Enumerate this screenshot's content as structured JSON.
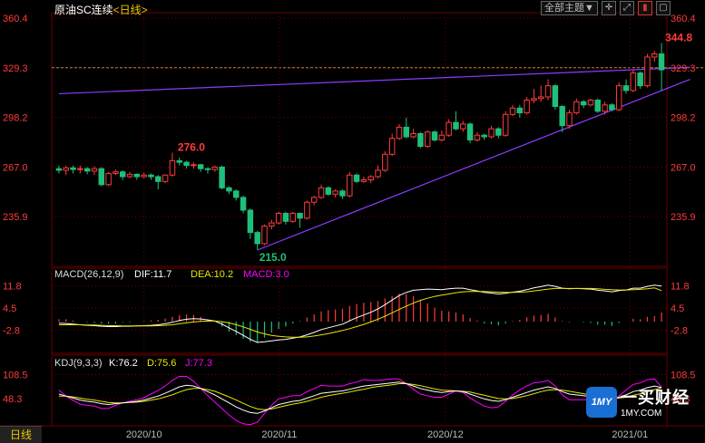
{
  "header": {
    "title": "原油SC连续",
    "period": "<日线>",
    "theme_button": "全部主题▼",
    "icons": [
      "crosshair-icon",
      "expand-icon",
      "chart-mode-icon",
      "window-icon"
    ]
  },
  "bottom_tab": "日线",
  "logo": {
    "badge": "1MY",
    "cn": "一买财经",
    "url": "1MY.COM"
  },
  "colors": {
    "up": "#ff3b3b",
    "down": "#1fbf7a",
    "trend": "#8a3cff",
    "dif": "#ffffff",
    "dea": "#e8e800",
    "macd_label": "#ff00ff",
    "k": "#ffffff",
    "d": "#e8e800",
    "j": "#ff00ff",
    "price_label": "#ff3b3b",
    "grid": "#6b0000"
  },
  "chart_data": [
    {
      "type": "candlestick",
      "ylim": [
        215.0,
        360.4
      ],
      "yticks": [
        "360.4",
        "329.3",
        "298.2",
        "267.0",
        "235.9"
      ],
      "xticks": [
        "2020/10",
        "2020/11",
        "2020/12",
        "2021/01"
      ],
      "last_price_ref": "329.3",
      "annotations": {
        "high": "344.8",
        "high_value": 344.8,
        "peak": "276.0",
        "peak_value": 276.0,
        "low": "215.0",
        "low_value": 215.0
      },
      "candles": [
        [
          266.0,
          265.0,
          268.0,
          263.0
        ],
        [
          265.0,
          266.5,
          268.0,
          262.0
        ],
        [
          266.5,
          265.5,
          268.0,
          263.0
        ],
        [
          265.5,
          266.0,
          268.0,
          263.0
        ],
        [
          266.0,
          264.5,
          267.0,
          262.5
        ],
        [
          264.5,
          266.0,
          267.5,
          262.0
        ],
        [
          266.0,
          256.0,
          267.0,
          255.0
        ],
        [
          256.0,
          263.0,
          264.0,
          255.0
        ],
        [
          263.0,
          264.0,
          265.5,
          262.0
        ],
        [
          264.0,
          261.0,
          265.0,
          259.0
        ],
        [
          261.0,
          262.5,
          264.0,
          260.0
        ],
        [
          262.5,
          261.0,
          263.0,
          259.0
        ],
        [
          261.0,
          262.0,
          263.5,
          260.0
        ],
        [
          262.0,
          261.0,
          263.0,
          259.0
        ],
        [
          261.0,
          258.0,
          262.0,
          253.0
        ],
        [
          258.0,
          262.0,
          262.5,
          257.0
        ],
        [
          262.0,
          271.0,
          276.0,
          261.0
        ],
        [
          271.0,
          270.0,
          273.0,
          268.0
        ],
        [
          270.0,
          268.0,
          271.0,
          266.0
        ],
        [
          268.0,
          268.5,
          270.0,
          266.0
        ],
        [
          268.5,
          266.0,
          269.0,
          264.0
        ],
        [
          266.0,
          265.5,
          267.0,
          263.0
        ],
        [
          265.5,
          267.0,
          268.0,
          264.0
        ],
        [
          267.0,
          254.0,
          268.0,
          253.0
        ],
        [
          254.0,
          252.0,
          255.0,
          250.0
        ],
        [
          252.0,
          248.0,
          253.0,
          246.0
        ],
        [
          248.0,
          240.0,
          249.0,
          238.0
        ],
        [
          240.0,
          226.0,
          241.0,
          222.0
        ],
        [
          226.0,
          219.0,
          227.0,
          215.0
        ],
        [
          219.0,
          230.0,
          231.0,
          218.0
        ],
        [
          230.0,
          232.0,
          234.0,
          228.0
        ],
        [
          232.0,
          238.0,
          239.0,
          231.0
        ],
        [
          238.0,
          233.0,
          239.0,
          231.0
        ],
        [
          233.0,
          238.0,
          239.0,
          232.0
        ],
        [
          238.0,
          235.0,
          238.5,
          229.0
        ],
        [
          235.0,
          245.0,
          246.0,
          234.0
        ],
        [
          245.0,
          248.0,
          249.0,
          243.0
        ],
        [
          248.0,
          254.0,
          256.0,
          247.0
        ],
        [
          254.0,
          250.0,
          255.0,
          249.0
        ],
        [
          250.0,
          252.0,
          253.0,
          248.0
        ],
        [
          252.0,
          249.0,
          253.0,
          247.0
        ],
        [
          249.0,
          262.0,
          264.0,
          248.0
        ],
        [
          262.0,
          258.0,
          263.0,
          257.0
        ],
        [
          258.0,
          259.0,
          261.0,
          257.0
        ],
        [
          259.0,
          261.0,
          262.0,
          257.0
        ],
        [
          261.0,
          265.0,
          268.0,
          260.0
        ],
        [
          265.0,
          275.0,
          277.0,
          264.0
        ],
        [
          275.0,
          285.0,
          288.0,
          274.0
        ],
        [
          285.0,
          292.0,
          294.0,
          284.0
        ],
        [
          292.0,
          286.0,
          298.0,
          285.0
        ],
        [
          286.0,
          288.0,
          291.0,
          285.0
        ],
        [
          288.0,
          280.0,
          289.0,
          279.0
        ],
        [
          280.0,
          289.0,
          290.0,
          279.0
        ],
        [
          289.0,
          284.0,
          290.0,
          283.0
        ],
        [
          284.0,
          287.0,
          290.0,
          283.0
        ],
        [
          287.0,
          295.0,
          297.0,
          286.0
        ],
        [
          295.0,
          291.0,
          302.0,
          290.0
        ],
        [
          291.0,
          294.0,
          296.0,
          289.0
        ],
        [
          294.0,
          284.0,
          295.0,
          282.0
        ],
        [
          284.0,
          287.0,
          289.0,
          283.0
        ],
        [
          287.0,
          286.0,
          288.0,
          284.0
        ],
        [
          286.0,
          291.0,
          293.0,
          285.0
        ],
        [
          291.0,
          287.0,
          292.0,
          285.0
        ],
        [
          287.0,
          300.0,
          302.0,
          286.0
        ],
        [
          300.0,
          304.0,
          306.0,
          299.0
        ],
        [
          304.0,
          301.0,
          306.0,
          298.0
        ],
        [
          301.0,
          309.0,
          311.0,
          300.0
        ],
        [
          309.0,
          310.0,
          316.0,
          307.0
        ],
        [
          310.0,
          311.0,
          318.0,
          308.0
        ],
        [
          311.0,
          318.0,
          322.0,
          309.0
        ],
        [
          318.0,
          305.0,
          319.0,
          303.0
        ],
        [
          305.0,
          293.0,
          306.0,
          289.0
        ],
        [
          293.0,
          301.0,
          303.0,
          291.0
        ],
        [
          301.0,
          308.0,
          310.0,
          300.0
        ],
        [
          308.0,
          306.0,
          309.0,
          304.0
        ],
        [
          306.0,
          309.0,
          310.0,
          305.0
        ],
        [
          309.0,
          302.0,
          310.0,
          301.0
        ],
        [
          302.0,
          306.0,
          308.0,
          300.0
        ],
        [
          306.0,
          303.0,
          307.0,
          302.0
        ],
        [
          303.0,
          318.0,
          320.0,
          302.0
        ],
        [
          318.0,
          315.0,
          322.0,
          313.0
        ],
        [
          315.0,
          326.0,
          328.0,
          314.0
        ],
        [
          326.0,
          318.0,
          327.0,
          316.0
        ],
        [
          318.0,
          336.0,
          338.0,
          317.0
        ],
        [
          336.0,
          338.0,
          340.0,
          333.0
        ],
        [
          338.0,
          328.0,
          344.8,
          315.0
        ]
      ],
      "trendlines": [
        {
          "from": [
            0,
            313.0
          ],
          "to": [
            88,
            329.5
          ]
        },
        {
          "from": [
            28,
            215.0
          ],
          "to": [
            88,
            322.0
          ]
        }
      ]
    },
    {
      "type": "macd",
      "label": "MACD(26,12,9)",
      "series_labels": {
        "dif": "DIF:11.7",
        "dea": "DEA:10.2",
        "macd": "MACD:3.0"
      },
      "ylim": [
        -8.0,
        14.0
      ],
      "yticks": [
        "11.8",
        "4.5",
        "-2.8"
      ],
      "dif": [
        -0.5,
        -0.6,
        -0.8,
        -1.0,
        -1.2,
        -1.3,
        -1.5,
        -1.6,
        -1.6,
        -1.5,
        -1.5,
        -1.4,
        -1.3,
        -1.2,
        -1.0,
        -0.7,
        -0.2,
        0.4,
        0.8,
        1.0,
        0.9,
        0.6,
        0.2,
        -0.8,
        -2.0,
        -3.2,
        -4.5,
        -5.8,
        -6.8,
        -6.6,
        -6.3,
        -6.0,
        -5.8,
        -5.4,
        -5.0,
        -4.3,
        -3.5,
        -2.6,
        -2.0,
        -1.4,
        -0.8,
        0.3,
        1.3,
        2.2,
        3.1,
        4.2,
        5.6,
        7.1,
        8.6,
        9.6,
        10.3,
        10.5,
        10.7,
        10.6,
        10.5,
        10.8,
        11.0,
        11.0,
        10.5,
        10.1,
        9.6,
        9.4,
        9.1,
        9.3,
        9.7,
        10.0,
        10.5,
        11.1,
        11.5,
        12.0,
        11.6,
        11.0,
        10.8,
        10.9,
        10.8,
        10.7,
        10.3,
        10.1,
        9.8,
        10.2,
        10.4,
        11.0,
        11.0,
        11.6,
        12.0,
        11.7
      ],
      "dea": [
        -1.0,
        -1.0,
        -1.0,
        -1.0,
        -1.1,
        -1.1,
        -1.2,
        -1.3,
        -1.3,
        -1.4,
        -1.4,
        -1.4,
        -1.4,
        -1.4,
        -1.3,
        -1.2,
        -1.0,
        -0.7,
        -0.4,
        -0.1,
        0.1,
        0.2,
        0.2,
        0.0,
        -0.4,
        -1.0,
        -1.7,
        -2.5,
        -3.4,
        -4.0,
        -4.5,
        -4.8,
        -5.0,
        -5.1,
        -5.1,
        -5.0,
        -4.7,
        -4.3,
        -3.9,
        -3.4,
        -2.9,
        -2.3,
        -1.6,
        -0.9,
        -0.1,
        0.8,
        1.8,
        2.9,
        4.0,
        5.1,
        6.1,
        7.0,
        7.7,
        8.3,
        8.7,
        9.1,
        9.5,
        9.8,
        9.9,
        9.9,
        9.9,
        9.8,
        9.7,
        9.6,
        9.6,
        9.7,
        9.8,
        10.1,
        10.4,
        10.7,
        10.9,
        10.9,
        10.9,
        10.9,
        10.9,
        10.9,
        10.8,
        10.6,
        10.5,
        10.4,
        10.4,
        10.5,
        10.6,
        10.8,
        11.1,
        10.2
      ],
      "hist": [
        0.8,
        0.8,
        0.4,
        0.0,
        -0.2,
        -0.4,
        -0.6,
        -0.6,
        -0.6,
        -0.2,
        -0.2,
        0.0,
        0.2,
        0.4,
        0.6,
        1.0,
        1.6,
        2.2,
        2.4,
        2.2,
        1.6,
        0.8,
        0.0,
        -1.6,
        -3.2,
        -4.4,
        -5.6,
        -6.6,
        -6.8,
        -5.2,
        -3.6,
        -2.4,
        -1.6,
        -0.6,
        0.2,
        1.4,
        2.4,
        3.4,
        3.8,
        4.0,
        4.2,
        5.2,
        5.8,
        6.2,
        6.4,
        6.8,
        7.6,
        8.4,
        9.2,
        9.0,
        8.4,
        7.0,
        6.0,
        4.6,
        3.6,
        3.4,
        3.0,
        2.4,
        1.2,
        0.4,
        -0.6,
        -0.8,
        -1.2,
        -0.6,
        0.2,
        0.6,
        1.4,
        2.0,
        2.2,
        2.6,
        1.4,
        0.2,
        -0.2,
        0.0,
        -0.2,
        -0.4,
        -1.0,
        -1.0,
        -1.4,
        -0.4,
        0.0,
        1.0,
        0.8,
        1.6,
        1.8,
        3.0
      ]
    },
    {
      "type": "kdj",
      "label": "KDJ(9,3,3)",
      "series_labels": {
        "k": "K:76.2",
        "d": "D:75.6",
        "j": "J:77.3"
      },
      "ylim": [
        -10.0,
        130.0
      ],
      "yticks": [
        "108.5",
        "48.3"
      ],
      "k": [
        60,
        55,
        50,
        45,
        42,
        40,
        36,
        34,
        36,
        38,
        40,
        42,
        45,
        50,
        55,
        62,
        70,
        78,
        82,
        80,
        74,
        66,
        58,
        48,
        38,
        28,
        20,
        14,
        12,
        18,
        26,
        34,
        38,
        42,
        44,
        50,
        56,
        62,
        64,
        66,
        68,
        72,
        76,
        80,
        82,
        84,
        86,
        88,
        90,
        86,
        80,
        74,
        70,
        66,
        64,
        66,
        68,
        66,
        60,
        54,
        48,
        44,
        42,
        46,
        52,
        58,
        64,
        70,
        74,
        78,
        74,
        66,
        60,
        58,
        56,
        54,
        50,
        48,
        46,
        52,
        58,
        66,
        70,
        76,
        80,
        76.2
      ],
      "d": [
        55,
        55,
        53,
        50,
        47,
        45,
        42,
        39,
        38,
        38,
        39,
        40,
        42,
        45,
        48,
        53,
        58,
        65,
        71,
        74,
        74,
        71,
        67,
        60,
        53,
        45,
        37,
        29,
        23,
        21,
        23,
        27,
        31,
        35,
        38,
        42,
        47,
        52,
        56,
        59,
        62,
        65,
        69,
        72,
        76,
        79,
        81,
        83,
        86,
        86,
        84,
        81,
        77,
        73,
        70,
        69,
        68,
        67,
        65,
        61,
        57,
        53,
        49,
        48,
        49,
        52,
        56,
        61,
        66,
        70,
        71,
        70,
        67,
        64,
        61,
        58,
        55,
        52,
        50,
        50,
        52,
        57,
        61,
        66,
        71,
        75.6
      ],
      "j": [
        70,
        55,
        44,
        35,
        32,
        30,
        24,
        24,
        32,
        38,
        42,
        46,
        51,
        60,
        69,
        80,
        94,
        104,
        104,
        92,
        74,
        56,
        40,
        24,
        8,
        -6,
        -14,
        -16,
        -10,
        12,
        32,
        48,
        52,
        56,
        56,
        66,
        74,
        82,
        80,
        80,
        80,
        86,
        90,
        96,
        94,
        94,
        96,
        98,
        98,
        86,
        72,
        60,
        56,
        52,
        52,
        60,
        68,
        64,
        50,
        40,
        30,
        26,
        28,
        42,
        58,
        70,
        80,
        88,
        90,
        94,
        80,
        58,
        46,
        46,
        46,
        46,
        40,
        40,
        38,
        56,
        70,
        84,
        88,
        96,
        98,
        77.3
      ]
    }
  ]
}
